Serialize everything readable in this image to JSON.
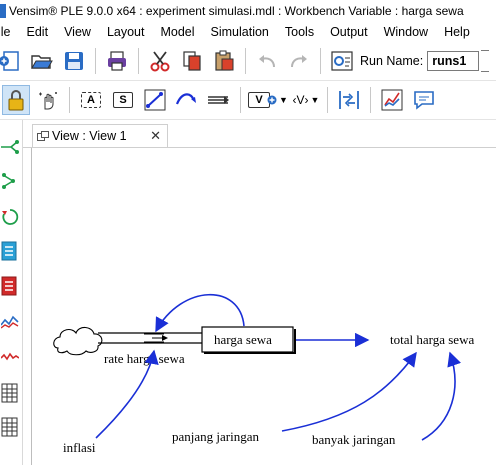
{
  "window": {
    "title": "Vensim® PLE 9.0.0 x64 : experiment simulasi.mdl : Workbench Variable : harga sewa"
  },
  "menu": {
    "items": [
      "ile",
      "Edit",
      "View",
      "Layout",
      "Model",
      "Simulation",
      "Tools",
      "Output",
      "Window",
      "Help"
    ]
  },
  "toolbar": {
    "run_name_label": "Run Name:",
    "run_name_value": "runs1",
    "box_a_label": "A",
    "box_s_label": "S",
    "var_label": "V",
    "shadow_label": "‹V›"
  },
  "tab": {
    "label": "View : View 1",
    "close": "✕"
  },
  "diagram": {
    "variables": {
      "harga_sewa": "harga sewa",
      "rate_harga_sewa": "rate harga sewa",
      "total_harga_sewa": "total harga sewa",
      "inflasi": "inflasi",
      "panjang_jaringan": "panjang jaringan",
      "banyak_jaringan": "banyak jaringan"
    }
  },
  "colors": {
    "arrow": "#1a2fd6",
    "accent": "#2a6cc4"
  }
}
